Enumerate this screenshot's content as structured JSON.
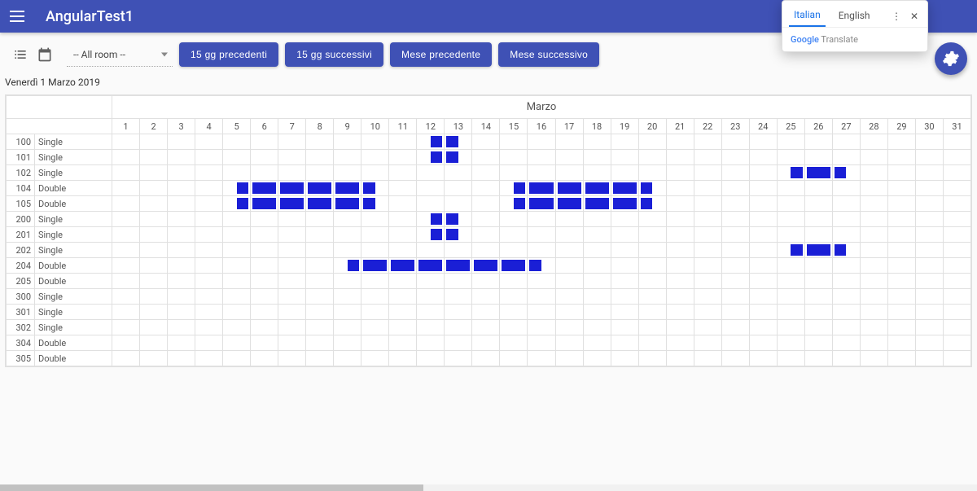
{
  "appbar": {
    "title": "AngularTest1"
  },
  "toolbar": {
    "room_select": "-- All room --",
    "btn_prev15": "15 gg precedenti",
    "btn_next15": "15 gg successivi",
    "btn_prev_month": "Mese precedente",
    "btn_next_month": "Mese successivo"
  },
  "date_label": "Venerdì 1 Marzo 2019",
  "month_header": "Marzo",
  "days": [
    "1",
    "2",
    "3",
    "4",
    "5",
    "6",
    "7",
    "8",
    "9",
    "10",
    "11",
    "12",
    "13",
    "14",
    "15",
    "16",
    "17",
    "18",
    "19",
    "20",
    "21",
    "22",
    "23",
    "24",
    "25",
    "26",
    "27",
    "28",
    "29",
    "30",
    "31"
  ],
  "rooms": [
    {
      "num": "100",
      "type": "Single",
      "bars": [
        {
          "d": 12,
          "k": "halfR"
        },
        {
          "d": 13,
          "k": "halfL"
        }
      ]
    },
    {
      "num": "101",
      "type": "Single",
      "bars": [
        {
          "d": 12,
          "k": "halfR"
        },
        {
          "d": 13,
          "k": "halfL"
        }
      ]
    },
    {
      "num": "102",
      "type": "Single",
      "bars": [
        {
          "d": 25,
          "k": "halfR"
        },
        {
          "d": 26,
          "k": "seg"
        },
        {
          "d": 27,
          "k": "halfL"
        }
      ]
    },
    {
      "num": "104",
      "type": "Double",
      "bars": [
        {
          "d": 5,
          "k": "halfR"
        },
        {
          "d": 6,
          "k": "seg"
        },
        {
          "d": 7,
          "k": "seg"
        },
        {
          "d": 8,
          "k": "seg"
        },
        {
          "d": 9,
          "k": "seg"
        },
        {
          "d": 10,
          "k": "halfL"
        },
        {
          "d": 15,
          "k": "halfR"
        },
        {
          "d": 16,
          "k": "seg"
        },
        {
          "d": 17,
          "k": "seg"
        },
        {
          "d": 18,
          "k": "seg"
        },
        {
          "d": 19,
          "k": "seg"
        },
        {
          "d": 20,
          "k": "halfL"
        }
      ]
    },
    {
      "num": "105",
      "type": "Double",
      "bars": [
        {
          "d": 5,
          "k": "halfR"
        },
        {
          "d": 6,
          "k": "seg"
        },
        {
          "d": 7,
          "k": "seg"
        },
        {
          "d": 8,
          "k": "seg"
        },
        {
          "d": 9,
          "k": "seg"
        },
        {
          "d": 10,
          "k": "halfL"
        },
        {
          "d": 15,
          "k": "halfR"
        },
        {
          "d": 16,
          "k": "seg"
        },
        {
          "d": 17,
          "k": "seg"
        },
        {
          "d": 18,
          "k": "seg"
        },
        {
          "d": 19,
          "k": "seg"
        },
        {
          "d": 20,
          "k": "halfL"
        }
      ]
    },
    {
      "num": "200",
      "type": "Single",
      "bars": [
        {
          "d": 12,
          "k": "halfR"
        },
        {
          "d": 13,
          "k": "halfL"
        }
      ]
    },
    {
      "num": "201",
      "type": "Single",
      "bars": [
        {
          "d": 12,
          "k": "halfR"
        },
        {
          "d": 13,
          "k": "halfL"
        }
      ]
    },
    {
      "num": "202",
      "type": "Single",
      "bars": [
        {
          "d": 25,
          "k": "halfR"
        },
        {
          "d": 26,
          "k": "seg"
        },
        {
          "d": 27,
          "k": "halfL"
        }
      ]
    },
    {
      "num": "204",
      "type": "Double",
      "bars": [
        {
          "d": 9,
          "k": "halfR"
        },
        {
          "d": 10,
          "k": "seg"
        },
        {
          "d": 11,
          "k": "halfL"
        },
        {
          "d": 11,
          "k": "halfR"
        },
        {
          "d": 12,
          "k": "seg"
        },
        {
          "d": 13,
          "k": "seg"
        },
        {
          "d": 14,
          "k": "halfL"
        },
        {
          "d": 14,
          "k": "halfR"
        },
        {
          "d": 15,
          "k": "seg"
        },
        {
          "d": 16,
          "k": "halfL"
        }
      ]
    },
    {
      "num": "205",
      "type": "Double",
      "bars": []
    },
    {
      "num": "300",
      "type": "Single",
      "bars": []
    },
    {
      "num": "301",
      "type": "Single",
      "bars": []
    },
    {
      "num": "302",
      "type": "Single",
      "bars": []
    },
    {
      "num": "304",
      "type": "Double",
      "bars": []
    },
    {
      "num": "305",
      "type": "Double",
      "bars": []
    }
  ],
  "translate": {
    "lang_active": "Italian",
    "lang_other": "English",
    "brand1": "Google",
    "brand2": " Translate"
  }
}
